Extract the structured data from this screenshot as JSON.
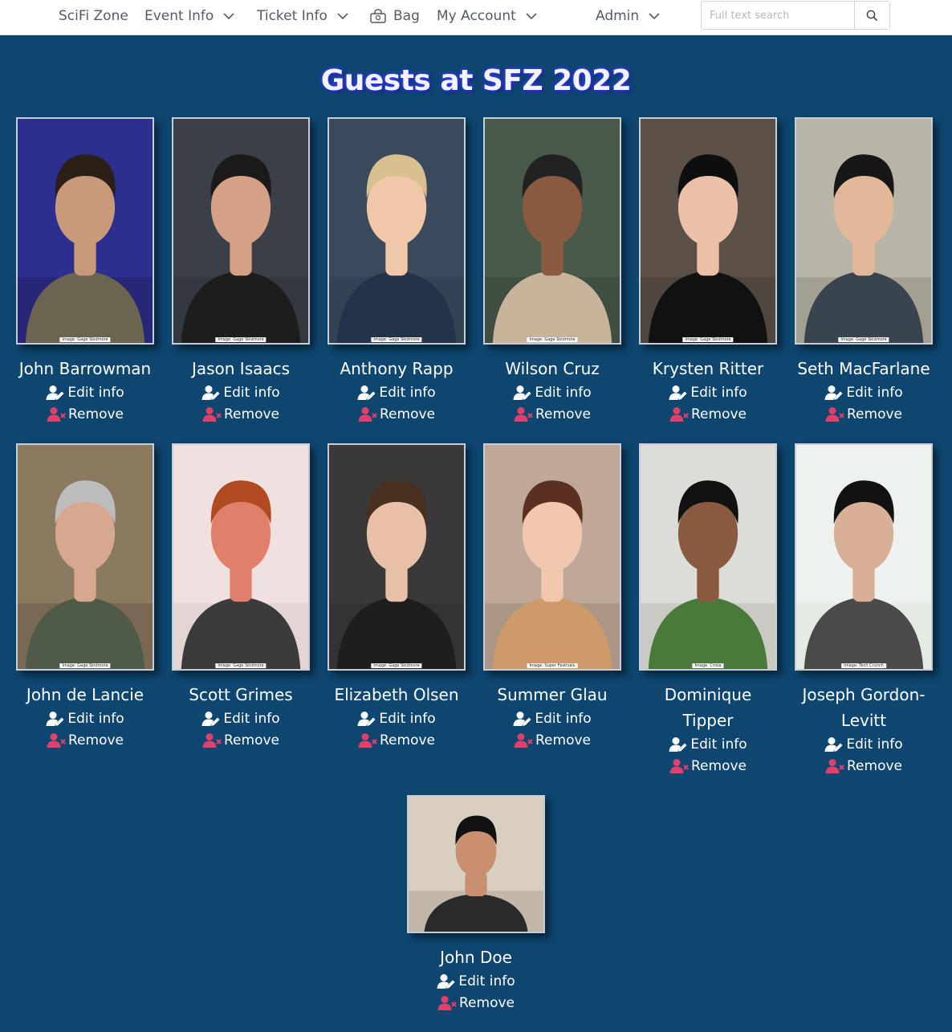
{
  "nav": {
    "brand": "SciFi Zone",
    "event_info": "Event Info",
    "ticket_info": "Ticket Info",
    "bag": "Bag",
    "my_account": "My Account",
    "admin": "Admin",
    "search_placeholder": "Full text search"
  },
  "page": {
    "title": "Guests at SFZ 2022"
  },
  "actions": {
    "edit": "Edit info",
    "remove": "Remove"
  },
  "guests": [
    {
      "name": "John Barrowman",
      "credit": "Image: Gage Skidmore"
    },
    {
      "name": "Jason Isaacs",
      "credit": "Image: Gage Skidmore"
    },
    {
      "name": "Anthony Rapp",
      "credit": "Image: Gage Skidmore"
    },
    {
      "name": "Wilson Cruz",
      "credit": "Image: Gage Skidmore"
    },
    {
      "name": "Krysten Ritter",
      "credit": "Image: Gage Skidmore"
    },
    {
      "name": "Seth MacFarlane",
      "credit": "Image: Gage Skidmore"
    },
    {
      "name": "John de Lancie",
      "credit": "Image: Gage Skidmore"
    },
    {
      "name": "Scott Grimes",
      "credit": "Image: Gage Skidmore"
    },
    {
      "name": "Elizabeth Olsen",
      "credit": "Image: Gage Skidmore"
    },
    {
      "name": "Summer Glau",
      "credit": "Image: Super Festivals"
    },
    {
      "name": "Dominique Tipper",
      "credit": "Image: Crosa"
    },
    {
      "name": "Joseph Gordon-Levitt",
      "credit": "Image: Tech Crunch"
    },
    {
      "name": "John Doe",
      "credit": ""
    }
  ],
  "colors": {
    "background": "#0e4670",
    "edit_icon": "#ffffff",
    "remove_icon": "#e0406a"
  }
}
